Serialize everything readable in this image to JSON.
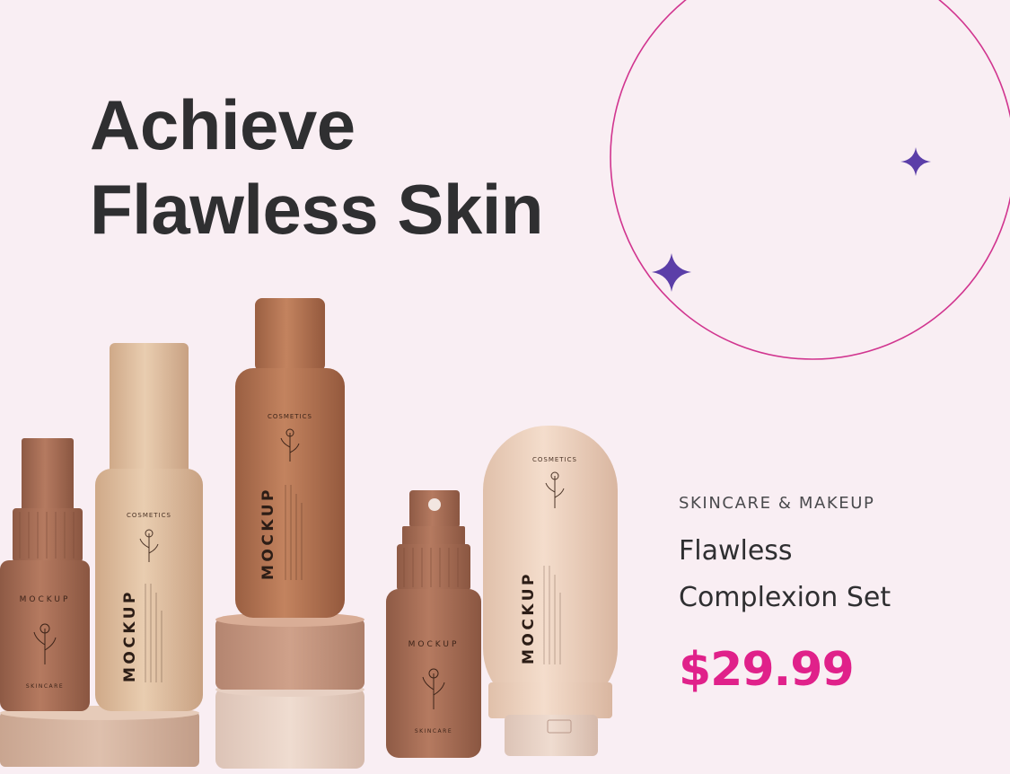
{
  "hero": {
    "headline_line1": "Achieve",
    "headline_line2": "Flawless Skin"
  },
  "product": {
    "category": "SKINCARE & MAKEUP",
    "name_line1": "Flawless",
    "name_line2": "Complexion Set",
    "price": "$29.99"
  },
  "packaging": {
    "brand_text": "MOCKUP",
    "label_text": "COSMETICS",
    "sub_label": "SKINCARE"
  },
  "colors": {
    "background": "#f9eef3",
    "accent_pink": "#e0218a",
    "sparkle_purple": "#5b3ea8",
    "circle_line": "#d1358f",
    "text_dark": "#2f2f31"
  },
  "icons": {
    "sparkle": "four-point-star-icon",
    "flower": "flower-sketch-icon"
  }
}
